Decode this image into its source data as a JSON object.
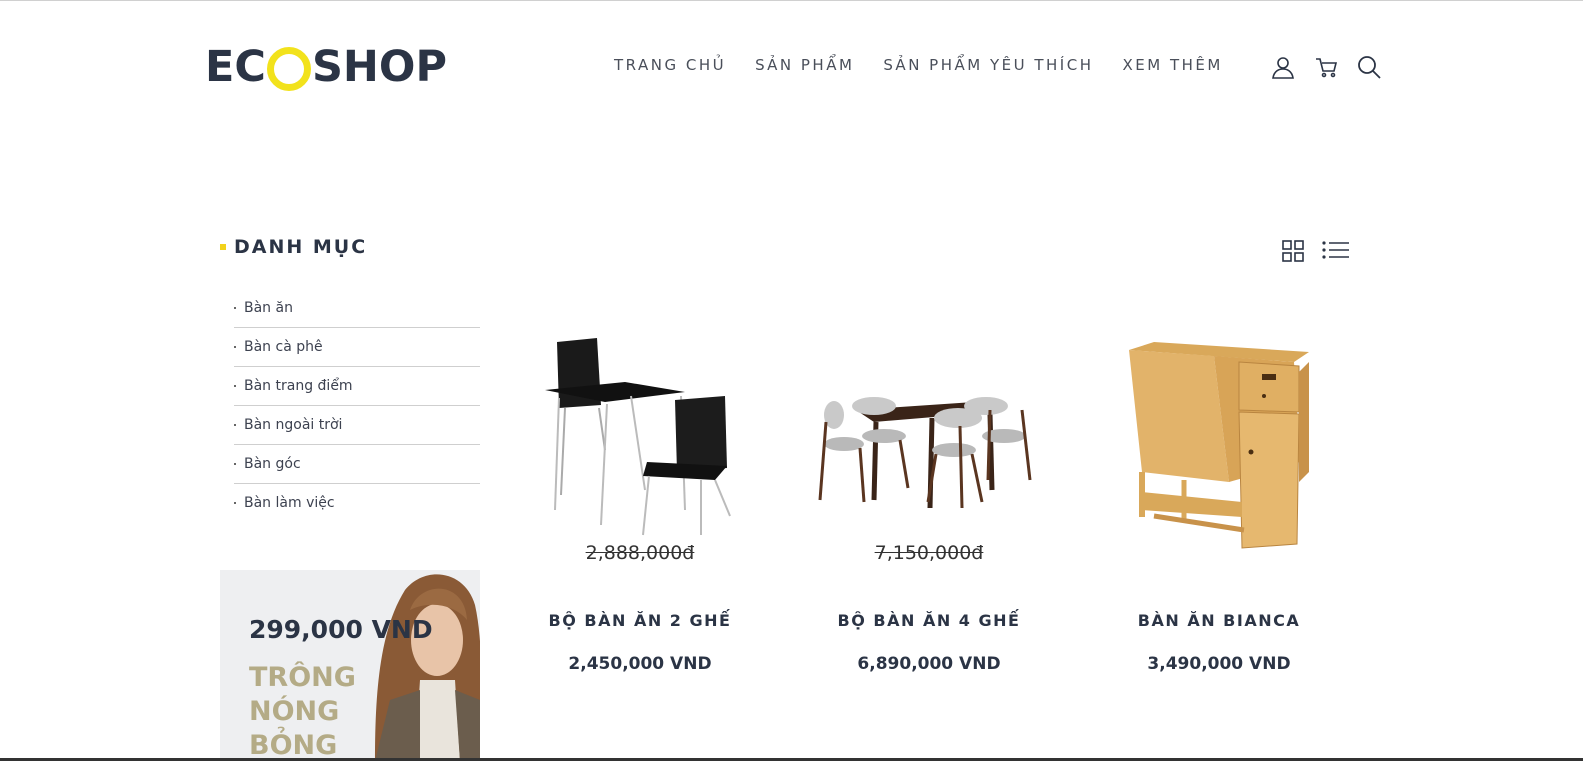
{
  "logo": {
    "part1": "E",
    "part2": "SHOP",
    "ring_color": "#f2e21c",
    "text_color": "#2b3445"
  },
  "nav": {
    "items": [
      {
        "label": "TRANG CHỦ"
      },
      {
        "label": "SẢN PHẨM"
      },
      {
        "label": "SẢN PHẨM YÊU THÍCH"
      },
      {
        "label": "XEM THÊM"
      }
    ],
    "icons": [
      "user-icon",
      "cart-icon",
      "search-icon"
    ]
  },
  "sidebar": {
    "title": "DANH MỤC",
    "items": [
      {
        "label": "Bàn ăn"
      },
      {
        "label": "Bàn cà phê"
      },
      {
        "label": "Bàn trang điểm"
      },
      {
        "label": "Bàn ngoài trời"
      },
      {
        "label": "Bàn góc"
      },
      {
        "label": "Bàn làm việc"
      }
    ],
    "promo": {
      "price": "299,000 VND",
      "line1": "TRÔNG",
      "line2": "NÓNG",
      "line3": "BỎNG"
    }
  },
  "view_toggle": {
    "icons": [
      "grid-view-icon",
      "list-view-icon"
    ]
  },
  "products": [
    {
      "old_price": "2,888,000đ",
      "name": "BỘ BÀN ĂN 2 GHẾ",
      "price": "2,450,000 VND"
    },
    {
      "old_price": "7,150,000đ",
      "name": "BỘ BÀN ĂN 4 GHẾ",
      "price": "6,890,000 VND"
    },
    {
      "old_price": "",
      "name": "BÀN ĂN BIANCA",
      "price": "3,490,000 VND"
    }
  ],
  "colors": {
    "accent_yellow": "#f2d21c",
    "text_dark": "#2b3445",
    "promo_gold": "#b4ab86"
  }
}
